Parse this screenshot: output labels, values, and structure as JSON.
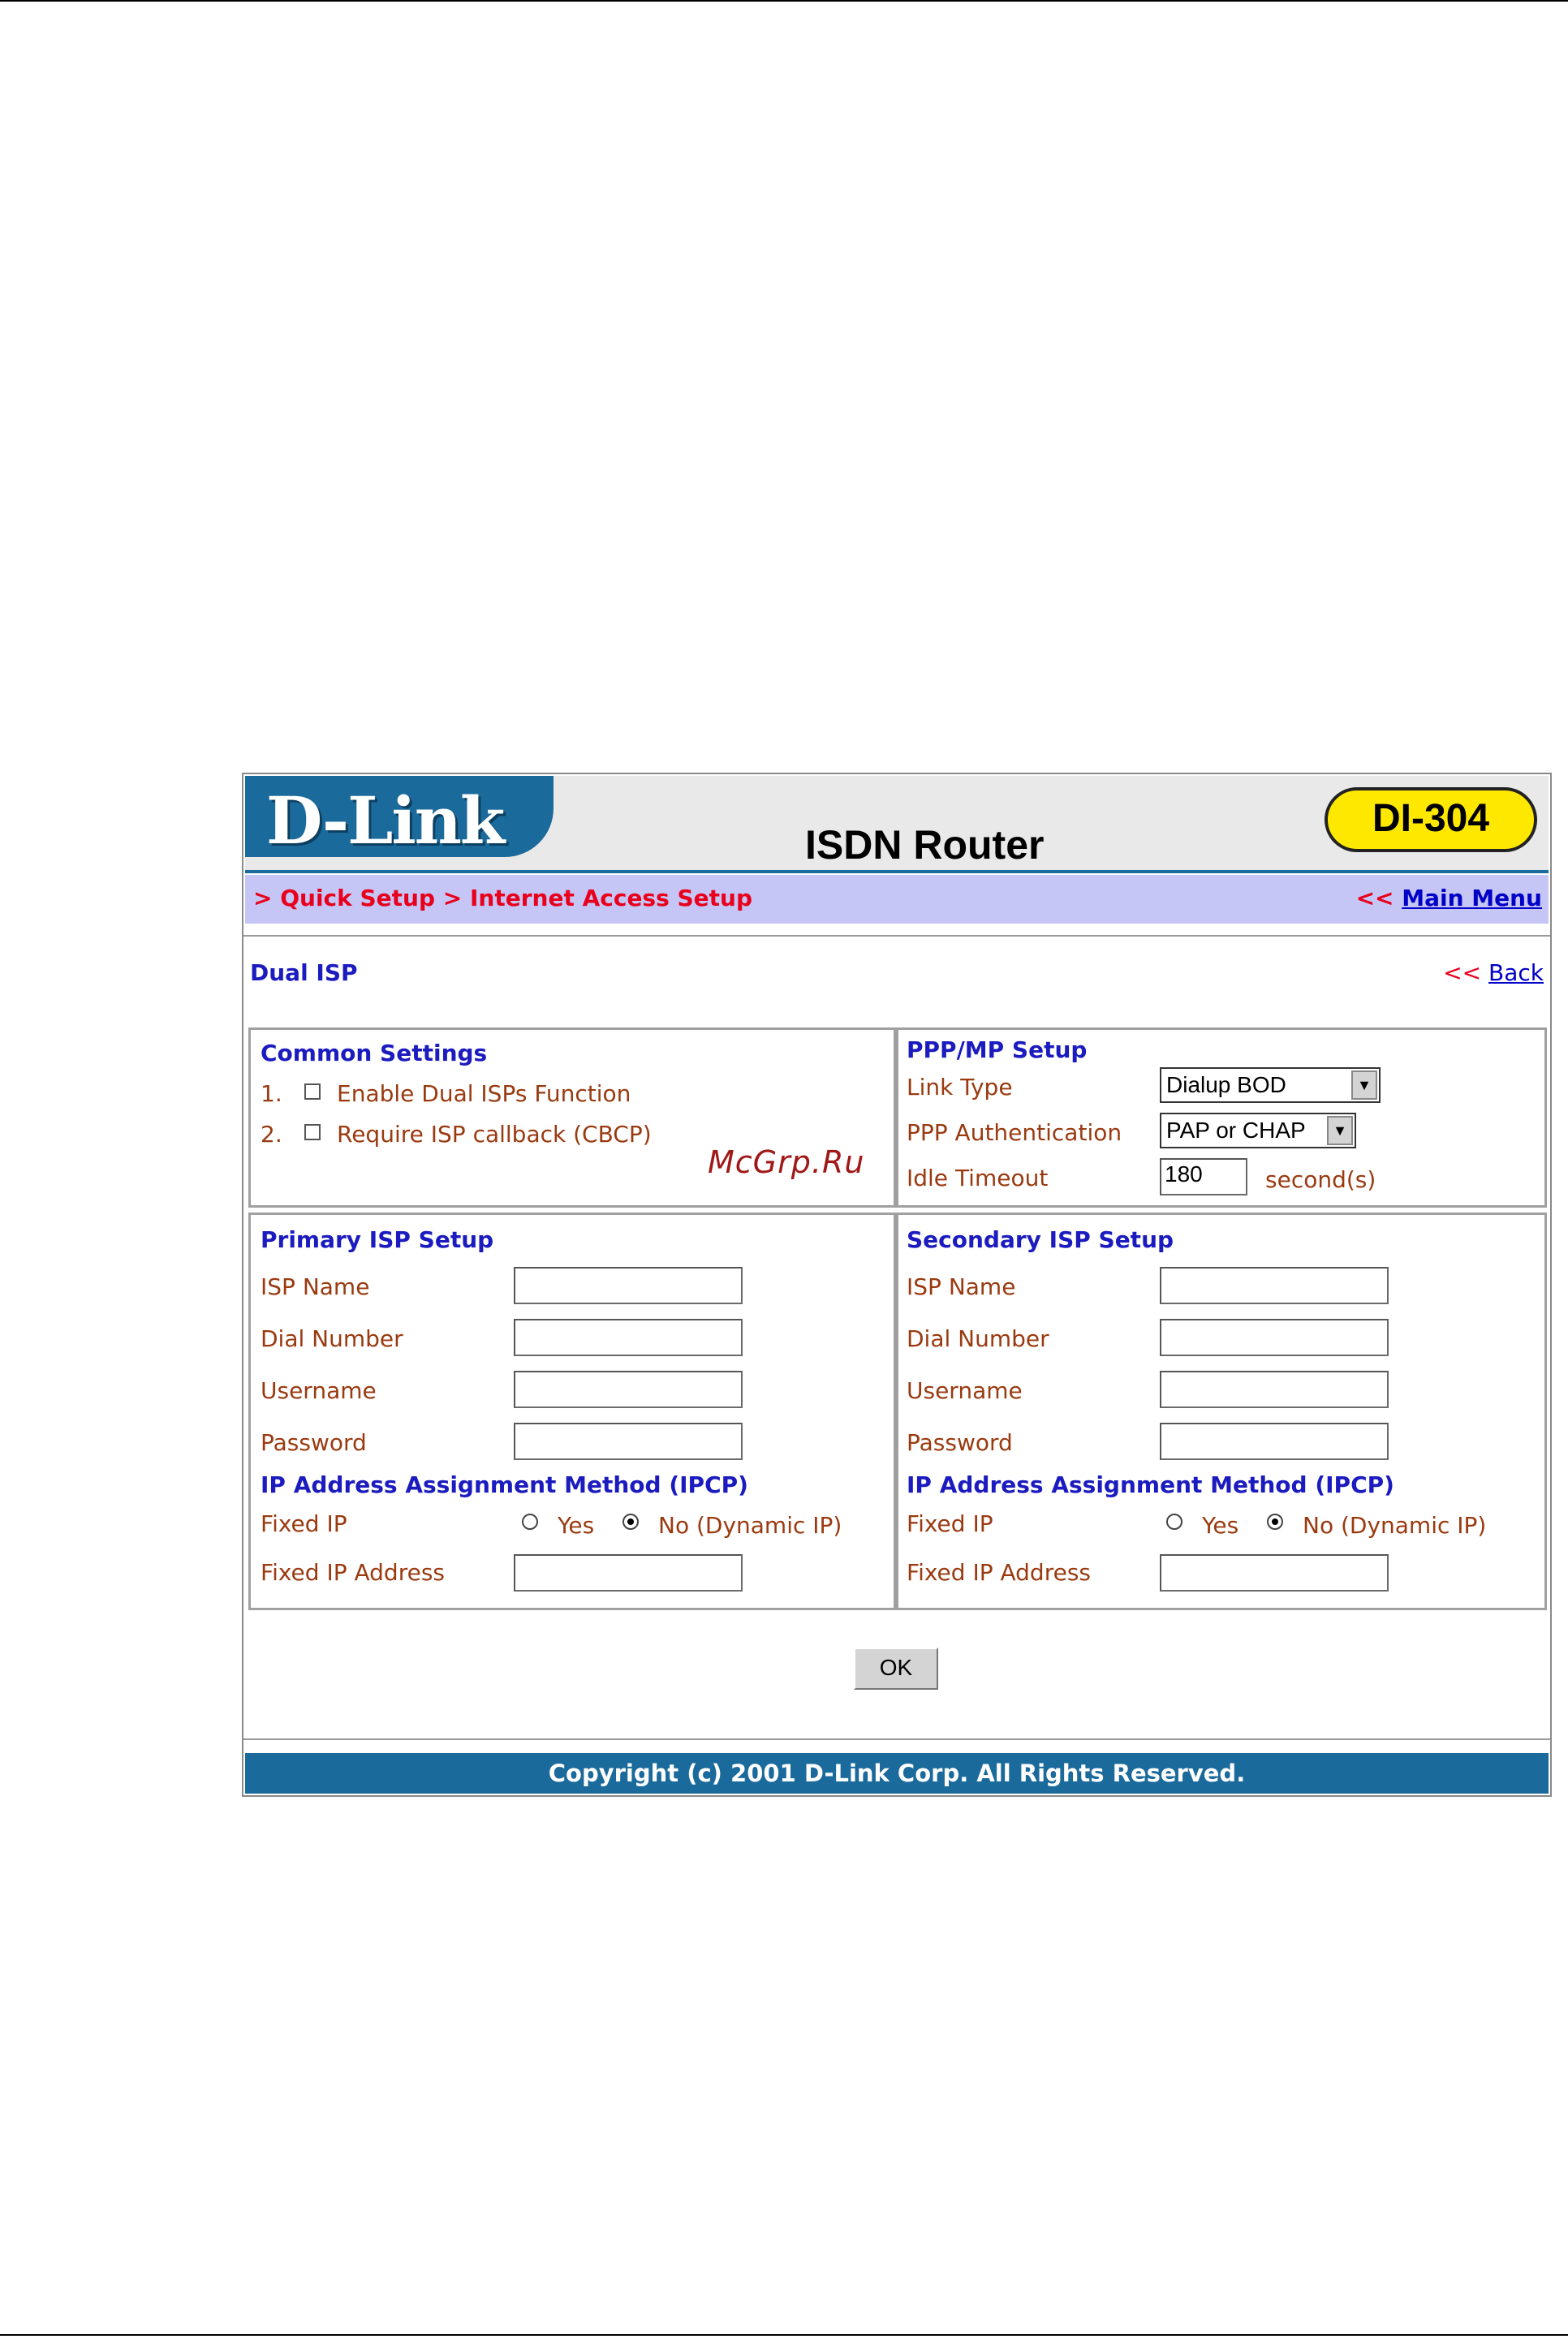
{
  "banner": {
    "logo": "D-Link",
    "product": "ISDN Router",
    "model": "DI-304"
  },
  "nav": {
    "breadcrumb": "> Quick Setup > Internet Access Setup",
    "main_menu_prefix": "<<",
    "main_menu_label": "Main Menu"
  },
  "page": {
    "title": "Dual ISP",
    "back_prefix": "<<",
    "back_label": "Back"
  },
  "common": {
    "heading": "Common Settings",
    "items": [
      {
        "num": "1.",
        "label": "Enable Dual ISPs Function",
        "checked": false
      },
      {
        "num": "2.",
        "label": "Require ISP callback (CBCP)",
        "checked": false
      }
    ]
  },
  "watermark": "McGrp.Ru",
  "ppp": {
    "heading": "PPP/MP Setup",
    "link_type_label": "Link Type",
    "link_type_value": "Dialup BOD",
    "auth_label": "PPP Authentication",
    "auth_value": "PAP or CHAP",
    "idle_label": "Idle Timeout",
    "idle_value": "180",
    "idle_unit": "second(s)"
  },
  "primary": {
    "heading": "Primary ISP Setup",
    "isp_name_label": "ISP Name",
    "dial_number_label": "Dial Number",
    "username_label": "Username",
    "password_label": "Password",
    "ipcp_heading": "IP Address Assignment Method (IPCP)",
    "fixed_ip_label": "Fixed IP",
    "yes_label": "Yes",
    "no_label": "No (Dynamic IP)",
    "selected": "no",
    "fixed_ip_address_label": "Fixed IP Address"
  },
  "secondary": {
    "heading": "Secondary ISP Setup",
    "isp_name_label": "ISP Name",
    "dial_number_label": "Dial Number",
    "username_label": "Username",
    "password_label": "Password",
    "ipcp_heading": "IP Address Assignment Method (IPCP)",
    "fixed_ip_label": "Fixed IP",
    "yes_label": "Yes",
    "no_label": "No (Dynamic IP)",
    "selected": "no",
    "fixed_ip_address_label": "Fixed IP Address"
  },
  "ok_label": "OK",
  "footer": "Copyright (c) 2001 D-Link Corp. All Rights Reserved.",
  "colors": {
    "brand_blue": "#1b6a9c",
    "breadcrumb_bar": "#c6c6f6",
    "heading_blue": "#1b1bbf",
    "label_brown": "#9a3a10",
    "nav_red": "#e8001c",
    "model_badge": "#ffe800"
  }
}
